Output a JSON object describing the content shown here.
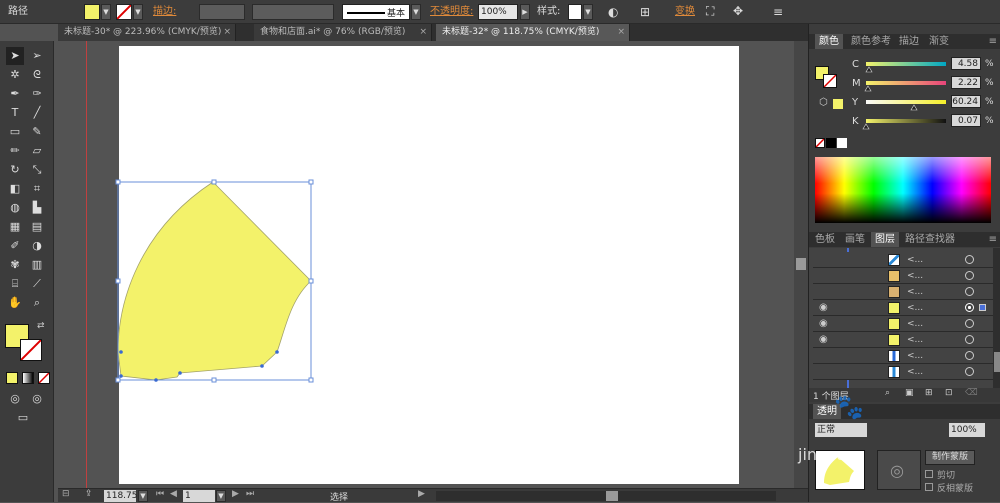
{
  "control_bar": {
    "object_label": "路径",
    "fill_color": "#f3f26a",
    "stroke_label": "描边:",
    "stroke_profile": "基本",
    "opacity_label": "不透明度:",
    "opacity_value": "100%",
    "style_label": "样式:",
    "transform_label": "变换"
  },
  "tabs": [
    {
      "label": "未标题-30* @ 223.96% (CMYK/预览)",
      "close": "×"
    },
    {
      "label": "食物和店面.ai* @ 76% (RGB/预览)",
      "close": "×"
    },
    {
      "label": "未标题-32* @ 118.75% (CMYK/预览)",
      "close": "×"
    }
  ],
  "color_panel": {
    "tabs": [
      "颜色",
      "颜色参考",
      "描边",
      "渐变"
    ],
    "channels": [
      {
        "name": "C",
        "value": "4.58",
        "unit": "%",
        "pos": 0.0458
      },
      {
        "name": "M",
        "value": "2.22",
        "unit": "%",
        "pos": 0.0222
      },
      {
        "name": "Y",
        "value": "60.24",
        "unit": "%",
        "pos": 0.6024
      },
      {
        "name": "K",
        "value": "0.07",
        "unit": "%",
        "pos": 0.0007
      }
    ],
    "swatch_color": "#f3f26a"
  },
  "layers_panel": {
    "tabs": [
      "色板",
      "画笔",
      "图层",
      "路径查找器"
    ],
    "rows": [
      "<...",
      "<...",
      "<...",
      "<...",
      "<...",
      "<...",
      "<...",
      "<..."
    ],
    "footer_text": "1 个图层"
  },
  "transparency_panel": {
    "tab": "透明",
    "mode": "正常",
    "opacity": "100%",
    "make_mask_button": "制作蒙版",
    "clip_label": "剪切",
    "invert_label": "反相蒙版"
  },
  "status_bar": {
    "zoom": "118.75",
    "page": "1",
    "tool": "选择"
  },
  "watermark": "jingyan"
}
